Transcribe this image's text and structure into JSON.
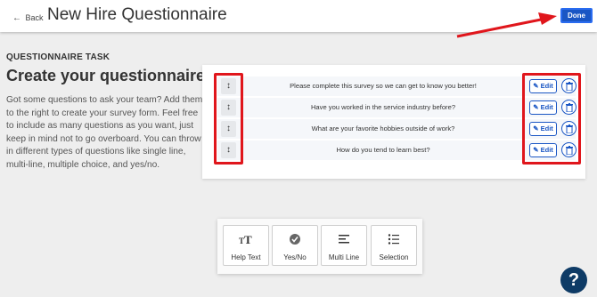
{
  "header": {
    "back_label": "Back",
    "title": "New Hire Questionnaire",
    "done_label": "Done"
  },
  "intro": {
    "task_label": "QUESTIONNAIRE TASK",
    "heading": "Create your questionnaire",
    "description": "Got some questions to ask your team? Add them to the right to create your survey form. Feel free to include as many questions as you want, just keep in mind not to go overboard. You can throw in different types of questions like single line, multi-line, multiple choice, and yes/no."
  },
  "questions": [
    {
      "text": "Please complete this survey so we can get to know you better!",
      "edit_label": "Edit"
    },
    {
      "text": "Have you worked in the service industry before?",
      "edit_label": "Edit"
    },
    {
      "text": "What are your favorite hobbies outside of work?",
      "edit_label": "Edit"
    },
    {
      "text": "How do you tend to learn best?",
      "edit_label": "Edit"
    }
  ],
  "question_types": [
    {
      "label": "Help Text",
      "icon": "text-size-icon"
    },
    {
      "label": "Yes/No",
      "icon": "check-circle-icon"
    },
    {
      "label": "Multi Line",
      "icon": "lines-icon"
    },
    {
      "label": "Selection",
      "icon": "list-icon"
    }
  ],
  "help_label": "?",
  "colors": {
    "primary": "#1a56c4",
    "annotation": "#e0161c",
    "help": "#0e3b66"
  }
}
